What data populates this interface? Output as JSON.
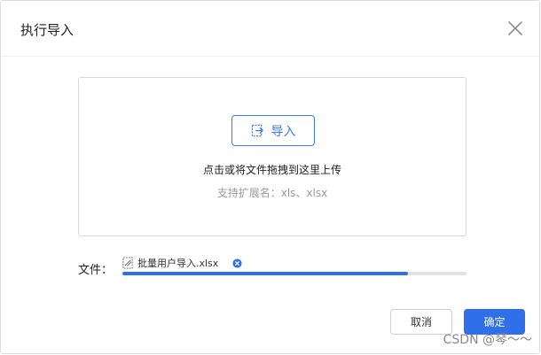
{
  "dialog": {
    "title": "执行导入"
  },
  "upload": {
    "button_label": "导入",
    "drop_hint": "点击或将文件拖拽到这里上传",
    "ext_hint": "支持扩展名：xls、xlsx"
  },
  "file": {
    "label": "文件：",
    "name": "批量用户导入.xlsx",
    "progress": 0.83
  },
  "footer": {
    "cancel_label": "取消",
    "ok_label": "确定"
  },
  "watermark": "CSDN @琴～～",
  "colors": {
    "primary": "#2f6fe8",
    "border": "#d9d9d9",
    "muted_text": "#9a9a9a"
  },
  "icons": {
    "close": "close-icon",
    "import": "import-file-icon",
    "file": "file-attachment-icon",
    "remove": "remove-circle-icon"
  }
}
